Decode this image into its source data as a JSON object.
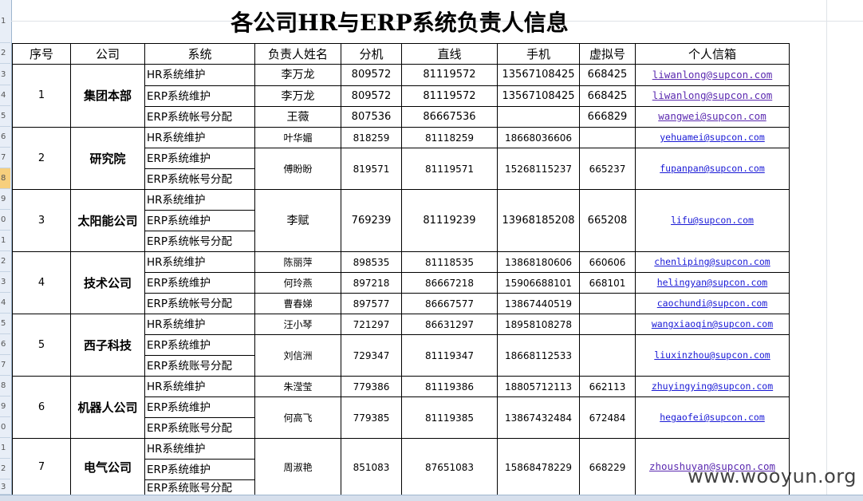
{
  "title": "各公司HR与ERP系统负责人信息",
  "row_numbers": [
    "1",
    "2",
    "3",
    "4",
    "5",
    "6",
    "7",
    "8",
    "9",
    "0",
    "1",
    "2",
    "3",
    "4",
    "5",
    "6",
    "7",
    "8",
    "9",
    "0",
    "1",
    "2",
    "3",
    "4"
  ],
  "headers": {
    "seq": "序号",
    "company": "公司",
    "system": "系统",
    "owner": "负责人姓名",
    "ext": "分机",
    "direct": "直线",
    "mobile": "手机",
    "virtual": "虚拟号",
    "email": "个人信箱"
  },
  "groups": [
    {
      "seq": "1",
      "company": "集团本部"
    },
    {
      "seq": "2",
      "company": "研究院"
    },
    {
      "seq": "3",
      "company": "太阳能公司"
    },
    {
      "seq": "4",
      "company": "技术公司"
    },
    {
      "seq": "5",
      "company": "西子科技"
    },
    {
      "seq": "6",
      "company": "机器人公司"
    },
    {
      "seq": "7",
      "company": "电气公司"
    }
  ],
  "systems": {
    "hr": "HR系统维护",
    "erp": "ERP系统维护",
    "erp_acct": "ERP系统帐号分配",
    "erp_acct2": "ERP系统账号分配"
  },
  "people": [
    {
      "name": "李万龙",
      "ext": "809572",
      "direct": "81119572",
      "mobile": "13567108425",
      "virtual": "668425",
      "email": "liwanlong@supcon.com "
    },
    {
      "name": "李万龙",
      "ext": "809572",
      "direct": "81119572",
      "mobile": "13567108425",
      "virtual": "668425",
      "email": "liwanlong@supcon.com "
    },
    {
      "name": "王薇",
      "ext": "807536",
      "direct": "86667536",
      "mobile": "",
      "virtual": "666829",
      "email": "wangwei@supcon.com"
    },
    {
      "name": "叶华媚",
      "ext": "818259",
      "direct": "81118259",
      "mobile": "18668036606",
      "virtual": "",
      "email": "yehuamei@supcon.com"
    },
    {
      "name": "傅盼盼",
      "ext": "819571",
      "direct": "81119571",
      "mobile": "15268115237",
      "virtual": "665237",
      "email": "fupanpan@supcon.com"
    },
    {
      "name": "李赋",
      "ext": "769239",
      "direct": "81119239",
      "mobile": "13968185208",
      "virtual": "665208",
      "email": "lifu@supcon.com"
    },
    {
      "name": "陈丽萍",
      "ext": "898535",
      "direct": "81118535",
      "mobile": "13868180606",
      "virtual": "660606",
      "email": "chenliping@supcon.com"
    },
    {
      "name": "何玲燕",
      "ext": "897218",
      "direct": "86667218",
      "mobile": "15906688101",
      "virtual": "668101",
      "email": "helingyan@supcon.com"
    },
    {
      "name": "曹春娣",
      "ext": "897577",
      "direct": "86667577",
      "mobile": "13867440519",
      "virtual": "",
      "email": "caochundi@supcon.com"
    },
    {
      "name": "汪小琴",
      "ext": "721297",
      "direct": "86631297",
      "mobile": "18958108278",
      "virtual": "",
      "email": "wangxiaoqin@supcon.com"
    },
    {
      "name": "刘信洲",
      "ext": "729347",
      "direct": "81119347",
      "mobile": "18668112533",
      "virtual": "",
      "email": "liuxinzhou@supcon.com"
    },
    {
      "name": "朱滢莹",
      "ext": "779386",
      "direct": "81119386",
      "mobile": "18805712113",
      "virtual": "662113",
      "email": "zhuyingying@supcon.com"
    },
    {
      "name": "何高飞",
      "ext": "779385",
      "direct": "81119385",
      "mobile": "13867432484",
      "virtual": "672484",
      "email": "hegaofei@supcon.com"
    },
    {
      "name": "周淑艳",
      "ext": "851083",
      "direct": "87651083",
      "mobile": "15868478229",
      "virtual": "668229",
      "email": "zhoushuyan@supcon.com"
    }
  ],
  "watermark": "www.wooyun.org"
}
